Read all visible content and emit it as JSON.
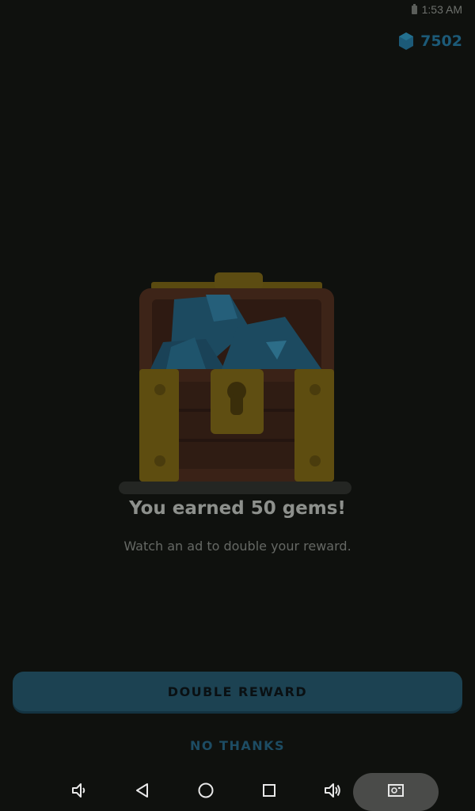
{
  "status_bar": {
    "time": "1:53 AM"
  },
  "header": {
    "gem_count": "7502"
  },
  "reward": {
    "title": "You earned 50 gems!",
    "subtitle": "Watch an ad to double your reward."
  },
  "actions": {
    "double_label": "DOUBLE REWARD",
    "no_thanks_label": "NO THANKS"
  },
  "nav": {
    "icons": [
      "volume-down-icon",
      "back-icon",
      "home-icon",
      "recents-icon",
      "volume-up-icon",
      "screenshot-icon"
    ]
  },
  "colors": {
    "background": "#0f110e",
    "button": "#1c4252",
    "gem": "#1c5a78"
  }
}
